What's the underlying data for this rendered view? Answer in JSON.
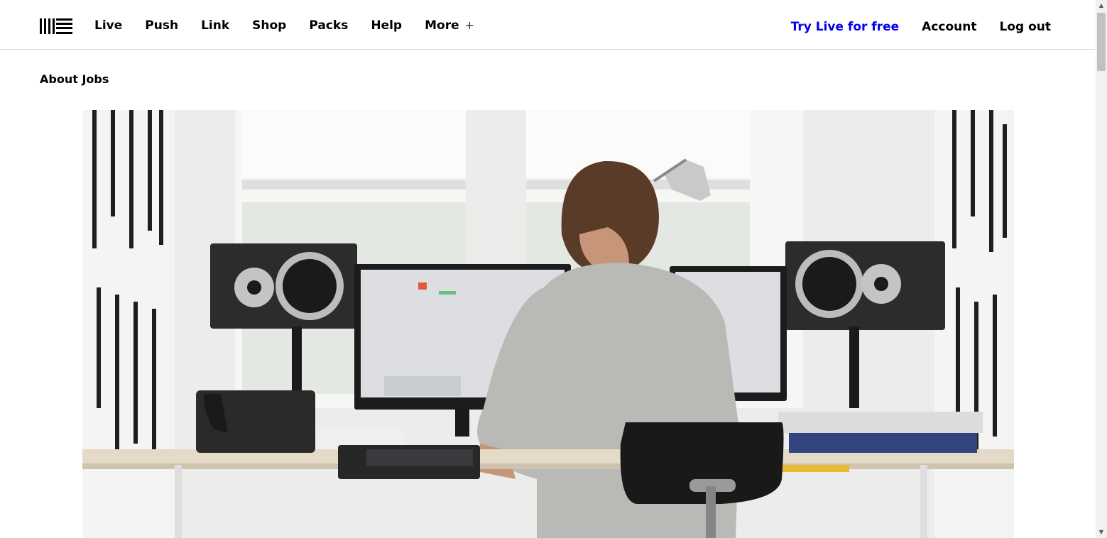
{
  "header": {
    "logo_icon": "ableton-logo-icon",
    "nav": [
      {
        "label": "Live"
      },
      {
        "label": "Push"
      },
      {
        "label": "Link"
      },
      {
        "label": "Shop"
      },
      {
        "label": "Packs"
      },
      {
        "label": "Help"
      },
      {
        "label": "More"
      }
    ],
    "more_icon": "plus-icon",
    "try_label": "Try Live for free",
    "account_label": "Account",
    "logout_label": "Log out",
    "accent_color": "#0000ee"
  },
  "subnav": {
    "title": "About Jobs"
  },
  "hero": {
    "description_icon": "studio-photo"
  },
  "scrollbar": {
    "up_icon": "arrow-up-icon",
    "down_icon": "arrow-down-icon"
  }
}
